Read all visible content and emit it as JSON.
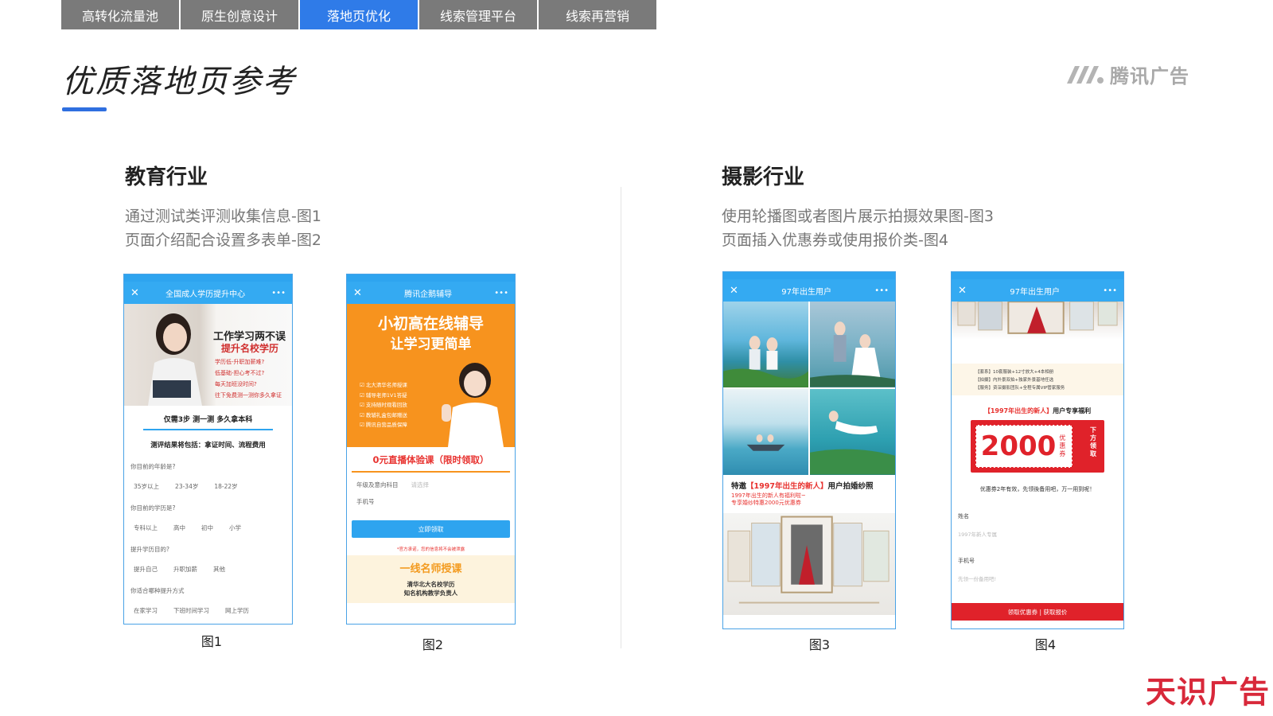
{
  "tabs": [
    {
      "label": "高转化流量池"
    },
    {
      "label": "原生创意设计"
    },
    {
      "label": "落地页优化"
    },
    {
      "label": "线索管理平台"
    },
    {
      "label": "线索再营销"
    }
  ],
  "active_tab": "落地页优化",
  "page_title": "优质落地页参考",
  "brand": {
    "icon": "tencent-ads-logo-icon",
    "name": "腾讯广告"
  },
  "sections": {
    "education": {
      "title": "教育行业",
      "desc_line1": "通过测试类评测收集信息-图1",
      "desc_line2": "页面介绍配合设置多表单-图2"
    },
    "photography": {
      "title": "摄影行业",
      "desc_line1": "使用轮播图或者图片展示拍摄效果图-图3",
      "desc_line2": "页面插入优惠券或使用报价类-图4"
    }
  },
  "figures": {
    "fig1": {
      "caption": "图1",
      "nav_title": "全国成人学历提升中心",
      "headline1": "工作学习两不误",
      "headline2": "提升名校学历",
      "bullets": [
        "学历低-升职加薪难?",
        "低基础-担心考不过?",
        "每天加班没时间?",
        "往下免费测一测你多久拿证"
      ],
      "strip1": "仅需3步 测一测 多久拿本科",
      "strip2": "测评结果将包括：拿证时间、流程费用",
      "q1": "你目前的年龄是?",
      "q1_opts": [
        "35岁以上",
        "23-34岁",
        "18-22岁"
      ],
      "q2": "你目前的学历是?",
      "q2_opts": [
        "专科以上",
        "高中",
        "初中",
        "小学"
      ],
      "q3": "提升学历目的?",
      "q3_opts": [
        "提升自己",
        "升职加薪",
        "其他"
      ],
      "q4": "你适合哪种提升方式",
      "q4_opts": [
        "在家学习",
        "下班时间学习",
        "网上学历"
      ]
    },
    "fig2": {
      "caption": "图2",
      "nav_title": "腾讯企鹅辅导",
      "h1": "小初高在线辅导",
      "h2": "让学习更简单",
      "list": [
        "北大清华名师授课",
        "辅导老师1V1答疑",
        "支持随时观看回放",
        "教辅礼盒包邮赠送",
        "腾讯自营品质保障"
      ],
      "free": "0元直播体验课（限时领取）",
      "field1_label": "年级及意向科目",
      "field1_ph": "请选择",
      "field2_label": "手机号",
      "button": "立即领取",
      "note": "*官方承诺，您的信息将不会被泄露",
      "bottom1": "一线名师授课",
      "bottom2": "清华北大名校学历",
      "bottom3": "知名机构教学负责人"
    },
    "fig3": {
      "caption": "图3",
      "nav_title": "97年出生用户",
      "text_prefix": "特邀",
      "text_red": "【1997年出生的新人】",
      "text_suffix": "用户拍婚纱照",
      "sub1": "1997年出生的新人有福利啦~",
      "sub2": "专享婚纱特惠2000元优惠券"
    },
    "fig4": {
      "caption": "图4",
      "nav_title": "97年出生用户",
      "info": [
        "【套系】10套服装+12寸放大+4本相册",
        "【拍摄】内外景双拍+独家外景基地任选",
        "【服务】资深摄影团队+全程专属VIP管家服务"
      ],
      "coupon_title_red": "【1997年出生的新人】",
      "coupon_title": "用户专享福利",
      "coupon_value": "2000",
      "coupon_unit": "优惠券",
      "coupon_side": "下方领取",
      "note": "优惠券2年有效，先领後备用吧，万一用到呢！",
      "label1": "姓名",
      "ph1": "1997年新人专属",
      "label2": "手机号",
      "ph2": "先领一份备用吧!",
      "button": "领取优惠券 | 获取报价"
    }
  },
  "watermark": "天识广告",
  "colors": {
    "tab_bg": "#7a7a7a",
    "tab_active": "#2f7be8",
    "accent": "#2f6fe0",
    "phone_blue": "#34aaf2",
    "red": "#e0222a",
    "orange": "#f7931e"
  }
}
